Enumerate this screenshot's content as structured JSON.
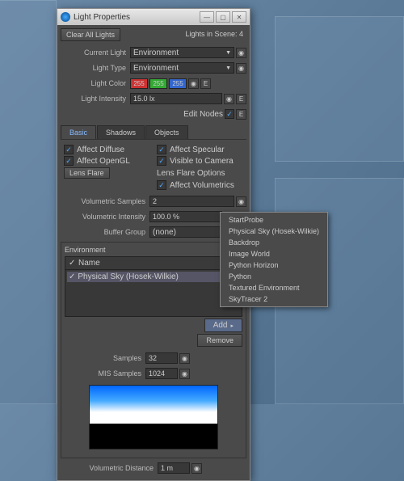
{
  "window": {
    "title": "Light Properties"
  },
  "top": {
    "clear": "Clear All Lights",
    "scene": "Lights in Scene: 4"
  },
  "props": {
    "current_light_label": "Current Light",
    "current_light": "Environment",
    "type_label": "Light Type",
    "type": "Environment",
    "color_label": "Light Color",
    "r": "255",
    "g": "255",
    "b": "255",
    "intensity_label": "Light Intensity",
    "intensity": "15.0 lx",
    "edit_nodes": "Edit Nodes"
  },
  "tabs": {
    "basic": "Basic",
    "shadows": "Shadows",
    "objects": "Objects"
  },
  "basic": {
    "affect_diffuse": "Affect Diffuse",
    "affect_specular": "Affect Specular",
    "affect_opengl": "Affect OpenGL",
    "visible_camera": "Visible to Camera",
    "lens_flare": "Lens Flare",
    "lens_flare_options": "Lens Flare Options",
    "affect_volumetrics": "Affect Volumetrics",
    "vol_samples_label": "Volumetric Samples",
    "vol_samples": "2",
    "vol_intensity_label": "Volumetric Intensity",
    "vol_intensity": "100.0 %",
    "buffer_group_label": "Buffer Group",
    "buffer_group": "(none)"
  },
  "env": {
    "title": "Environment",
    "name_hdr": "Name",
    "item": "Physical Sky (Hosek-Wilkie)",
    "add": "Add",
    "remove": "Remove",
    "samples_label": "Samples",
    "samples": "32",
    "mis_label": "MIS Samples",
    "mis": "1024"
  },
  "menu": {
    "items": [
      "StartProbe",
      "Physical Sky (Hosek-Wilkie)",
      "Backdrop",
      "Image World",
      "Python Horizon",
      "Python",
      "Textured Environment",
      "SkyTracer 2"
    ]
  },
  "footer": {
    "vol_dist_label": "Volumetric Distance",
    "vol_dist": "1 m"
  }
}
